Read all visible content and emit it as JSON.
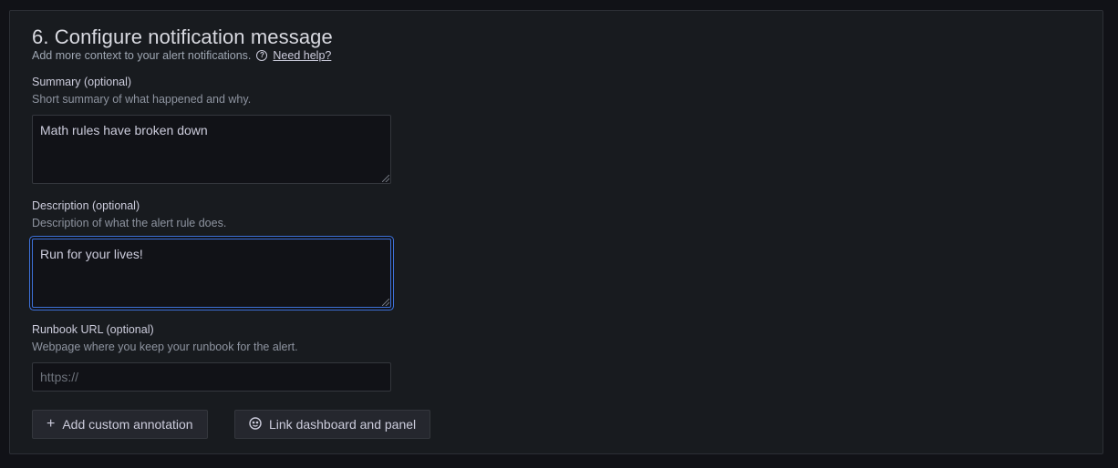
{
  "section": {
    "title": "6. Configure notification message",
    "subtitle": "Add more context to your alert notifications.",
    "help_link": "Need help?"
  },
  "summary": {
    "label": "Summary (optional)",
    "description": "Short summary of what happened and why.",
    "value": "Math rules have broken down"
  },
  "description_field": {
    "label": "Description (optional)",
    "description": "Description of what the alert rule does.",
    "value": "Run for your lives!"
  },
  "runbook": {
    "label": "Runbook URL (optional)",
    "description": "Webpage where you keep your runbook for the alert.",
    "value": "",
    "placeholder": "https://"
  },
  "buttons": {
    "add_annotation": "Add custom annotation",
    "link_dashboard": "Link dashboard and panel"
  },
  "icons": {
    "help": "question-circle-icon",
    "plus": "plus-icon",
    "dashboard": "apps-icon"
  }
}
